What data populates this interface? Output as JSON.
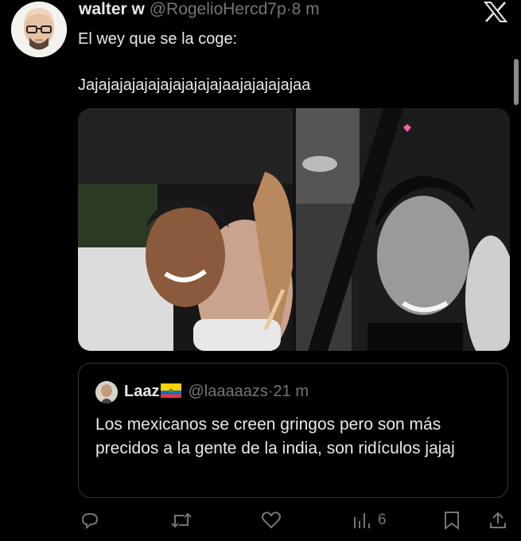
{
  "tweet": {
    "display_name": "walter w",
    "handle": "@RogelioHercd7p",
    "separator": "·",
    "time": "8 m",
    "line1": "El wey que se la coge:",
    "line2": "Jajajajajajajajajajajajaajajajajajaa"
  },
  "quote": {
    "display_name": "Laaz",
    "flag_icon": "ecuador-flag-icon",
    "handle": "@laaaaazs",
    "separator": "·",
    "time": "21 m",
    "text": "Los mexicanos se creen gringos pero son más precidos a la gente de la india, son ridículos jajaj"
  },
  "actions": {
    "reply_icon": "reply-icon",
    "retweet_icon": "retweet-icon",
    "like_icon": "heart-icon",
    "views_icon": "views-icon",
    "views_count": "6",
    "bookmark_icon": "bookmark-icon",
    "share_icon": "share-icon"
  },
  "colors": {
    "background": "#000000",
    "text": "#e7e9ea",
    "secondary": "#71767b",
    "border": "#2f3336"
  }
}
